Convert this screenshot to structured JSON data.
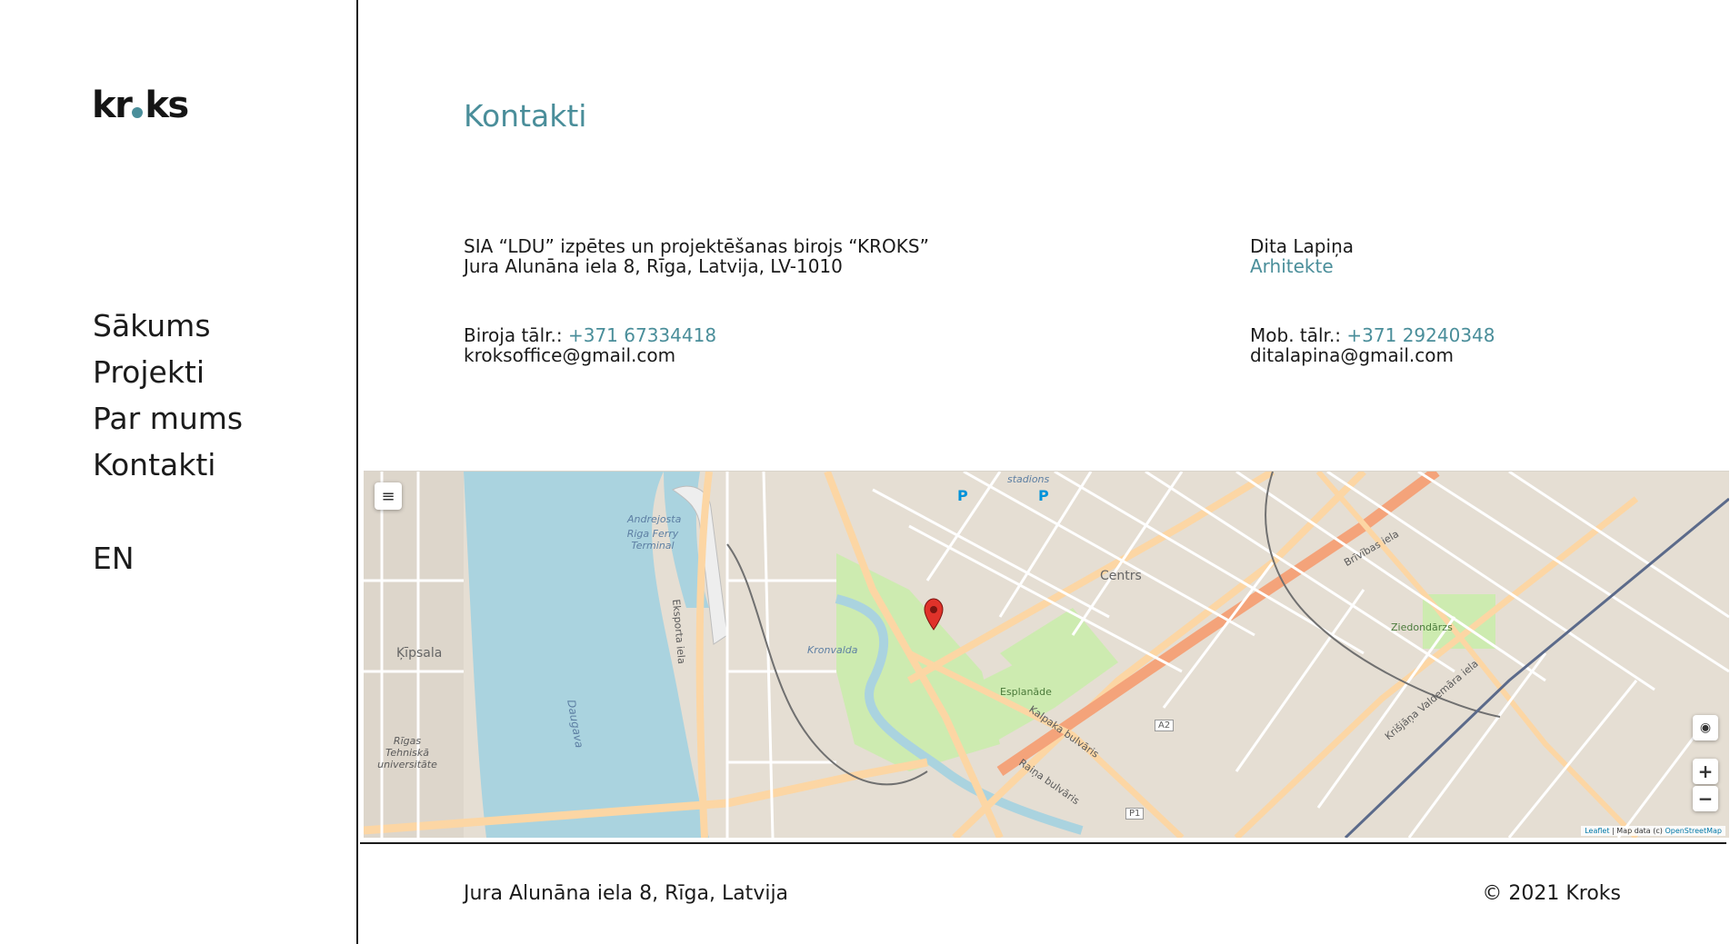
{
  "brand": {
    "logo_left": "kr",
    "logo_right": "ks",
    "accent": "#4a8e9a"
  },
  "nav": {
    "items": [
      {
        "label": "Sākums"
      },
      {
        "label": "Projekti"
      },
      {
        "label": "Par mums"
      },
      {
        "label": "Kontakti"
      }
    ],
    "language": "EN"
  },
  "page": {
    "title": "Kontakti"
  },
  "office": {
    "company": "SIA “LDU” izpētes un projektēšanas birojs “KROKS”",
    "address": "Jura Alunāna iela 8, Rīga, Latvija, LV-1010",
    "phone_label": "Biroja tālr.: ",
    "phone": "+371 67334418",
    "email": "kroksoffice@gmail.com"
  },
  "person": {
    "name": "Dita Lapiņa",
    "role": "Arhitekte",
    "phone_label": "Mob. tālr.: ",
    "phone": "+371 29240348",
    "email": "ditalapina@gmail.com"
  },
  "map": {
    "menu_icon": "menu-icon",
    "locate_icon": "locate-icon",
    "zoom_in": "+",
    "zoom_out": "−",
    "attribution_leaflet": "Leaflet",
    "attribution_text": " | Map data (c) ",
    "attribution_osm": "OpenStreetMap",
    "labels": {
      "centrs": "Centrs",
      "kipsala": "Ķīpsala",
      "daugava": "Daugava",
      "riga_ferry": "Riga Ferry Terminal",
      "kronvalda": "Kronvalda",
      "esplanade": "Esplanāde",
      "ziedondarzs": "Ziedondārzs",
      "stadions": "stadions",
      "rtu": "Rīgas Tehniskā universitāte",
      "brivibas": "Brīvības iela",
      "valdemara": "Krišjāņa Valdemāra iela",
      "eksporta": "Eksporta iela",
      "raina": "Raiņa bulvāris",
      "kalpaka": "Kalpaka bulvāris",
      "andrejosta": "Andrejosta",
      "a2": "A2",
      "p1": "P1"
    }
  },
  "footer": {
    "address": "Jura Alunāna iela 8, Rīga, Latvija",
    "copyright": "© 2021 Kroks"
  }
}
